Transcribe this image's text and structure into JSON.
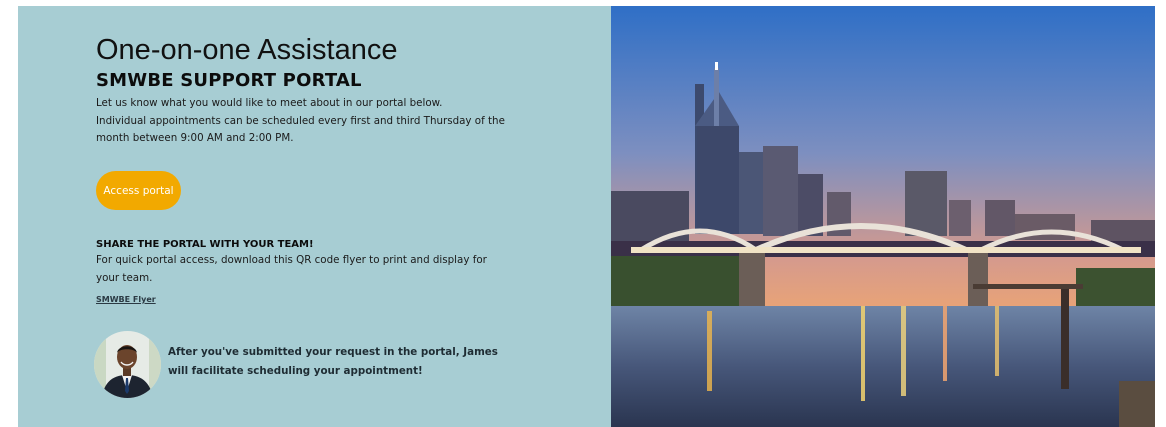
{
  "hero": {
    "title": "One-on-one Assistance",
    "subtitle": "SMWBE SUPPORT PORTAL",
    "description_line1": "Let us know what you would like to meet about in our portal below.",
    "description_line2": "Individual appointments can be scheduled every first and third Thursday of the month between 9:00 AM and 2:00 PM.",
    "cta_label": "Access portal"
  },
  "share": {
    "title": "SHARE THE PORTAL WITH YOUR TEAM!",
    "text": "For quick portal access, download this QR code flyer to print and display for your team.",
    "link_label": "SMWBE Flyer"
  },
  "facilitator": {
    "text": "After you've submitted your request in the portal, James will facilitate scheduling your appointment!"
  },
  "colors": {
    "panel_bg": "#a7cdd3",
    "button_bg": "#f2a900",
    "button_text": "#ffffff"
  },
  "image": {
    "icon": "city-skyline-bridge-photo"
  }
}
